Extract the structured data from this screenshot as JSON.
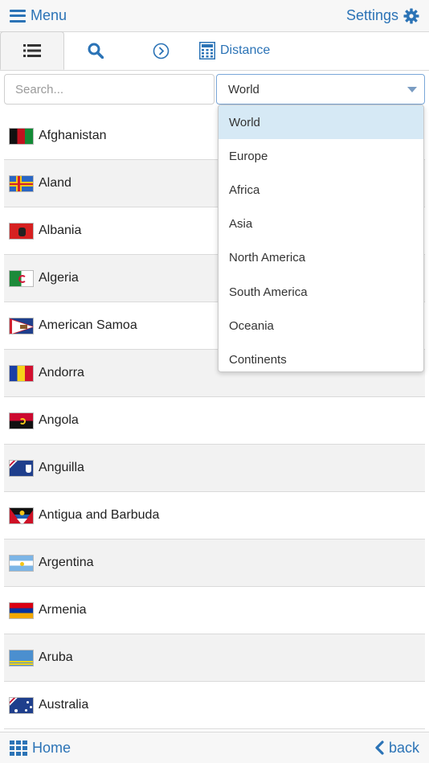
{
  "header": {
    "menu_label": "Menu",
    "settings_label": "Settings",
    "menu_icon": "hamburger-icon",
    "settings_icon": "gear-icon"
  },
  "tabs": [
    {
      "name": "list",
      "icon": "list-icon",
      "active": true
    },
    {
      "name": "search",
      "icon": "search-icon"
    },
    {
      "name": "navigate",
      "icon": "chevron-right-circle-icon"
    },
    {
      "name": "distance",
      "icon": "calculator-icon",
      "label": "Distance"
    }
  ],
  "filters": {
    "search_placeholder": "Search...",
    "region_selected": "World"
  },
  "region_options": [
    "World",
    "Europe",
    "Africa",
    "Asia",
    "North America",
    "South America",
    "Oceania",
    "Continents"
  ],
  "countries": [
    {
      "name": "Afghanistan"
    },
    {
      "name": "Aland"
    },
    {
      "name": "Albania"
    },
    {
      "name": "Algeria"
    },
    {
      "name": "American Samoa"
    },
    {
      "name": "Andorra"
    },
    {
      "name": "Angola"
    },
    {
      "name": "Anguilla"
    },
    {
      "name": "Antigua and Barbuda"
    },
    {
      "name": "Argentina"
    },
    {
      "name": "Armenia"
    },
    {
      "name": "Aruba"
    },
    {
      "name": "Australia"
    }
  ],
  "footer": {
    "home_label": "Home",
    "back_label": "back"
  },
  "colors": {
    "accent": "#2b73b6",
    "selected_option": "#d6e9f5",
    "row_alt": "#f2f2f2"
  }
}
